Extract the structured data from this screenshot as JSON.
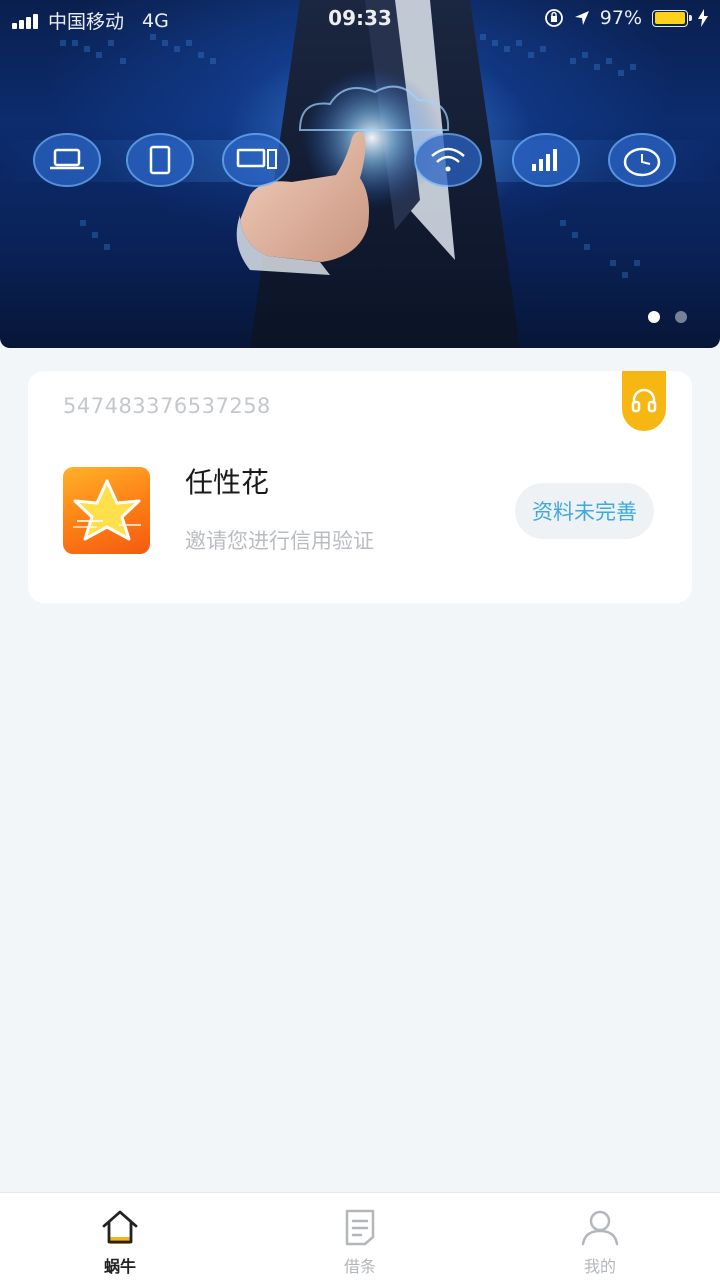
{
  "status_bar": {
    "carrier": "中国移动",
    "network": "4G",
    "time": "09:33",
    "battery": "97%",
    "battery_level": 0.97,
    "icons": [
      "signal-bars-icon",
      "orientation-lock-icon",
      "location-arrow-icon",
      "battery-icon",
      "charging-bolt-icon"
    ]
  },
  "banner": {
    "icons": [
      "laptop-icon",
      "tablet-icon",
      "desktop-icon",
      "wifi-icon",
      "signal-icon",
      "clock-icon"
    ],
    "slide_count": 2,
    "active_slide": 1
  },
  "card": {
    "id_number": "547483376537258",
    "product_name": "任性花",
    "product_desc": "邀请您进行信用验证",
    "status_button": "资料未完善",
    "support_icon": "headset-icon",
    "logo_icon": "star-logo-icon"
  },
  "colors": {
    "accent_yellow": "#f7b712",
    "status_text_blue": "#3fa9dd",
    "page_background": "#f2f6f9"
  },
  "tabbar": {
    "active_index": 0,
    "tabs": [
      {
        "label": "蜗牛",
        "icon": "home-icon"
      },
      {
        "label": "借条",
        "icon": "document-icon"
      },
      {
        "label": "我的",
        "icon": "user-icon"
      }
    ]
  }
}
